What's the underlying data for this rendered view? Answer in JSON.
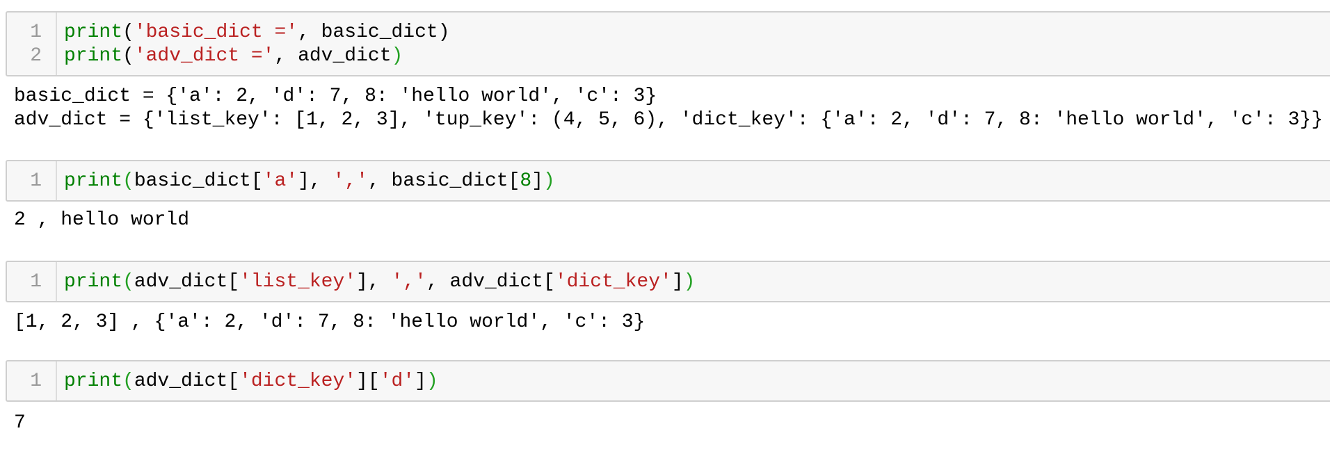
{
  "cells": [
    {
      "lines": [
        {
          "num": "1",
          "tokens": [
            {
              "t": "print",
              "c": "kw"
            },
            {
              "t": "(",
              "c": ""
            },
            {
              "t": "'basic_dict ='",
              "c": "str"
            },
            {
              "t": ", basic_dict)",
              "c": ""
            }
          ]
        },
        {
          "num": "2",
          "tokens": [
            {
              "t": "print",
              "c": "kw"
            },
            {
              "t": "(",
              "c": ""
            },
            {
              "t": "'adv_dict ='",
              "c": "str"
            },
            {
              "t": ", adv_dict",
              "c": ""
            },
            {
              "t": ")",
              "c": "bracket-match"
            }
          ]
        }
      ],
      "output": [
        "basic_dict = {'a': 2, 'd': 7, 8: 'hello world', 'c': 3}",
        "adv_dict = {'list_key': [1, 2, 3], 'tup_key': (4, 5, 6), 'dict_key': {'a': 2, 'd': 7, 8: 'hello world', 'c': 3}}"
      ]
    },
    {
      "lines": [
        {
          "num": "1",
          "tokens": [
            {
              "t": "print",
              "c": "kw"
            },
            {
              "t": "(",
              "c": "bracket-match"
            },
            {
              "t": "basic_dict[",
              "c": ""
            },
            {
              "t": "'a'",
              "c": "str"
            },
            {
              "t": "], ",
              "c": ""
            },
            {
              "t": "','",
              "c": "str"
            },
            {
              "t": ", basic_dict[",
              "c": ""
            },
            {
              "t": "8",
              "c": "num"
            },
            {
              "t": "]",
              "c": ""
            },
            {
              "t": ")",
              "c": "bracket-match"
            }
          ]
        }
      ],
      "output": [
        "2 , hello world"
      ]
    },
    {
      "lines": [
        {
          "num": "1",
          "tokens": [
            {
              "t": "print",
              "c": "kw"
            },
            {
              "t": "(",
              "c": "bracket-match"
            },
            {
              "t": "adv_dict[",
              "c": ""
            },
            {
              "t": "'list_key'",
              "c": "str"
            },
            {
              "t": "], ",
              "c": ""
            },
            {
              "t": "','",
              "c": "str"
            },
            {
              "t": ", adv_dict[",
              "c": ""
            },
            {
              "t": "'dict_key'",
              "c": "str"
            },
            {
              "t": "]",
              "c": ""
            },
            {
              "t": ")",
              "c": "bracket-match"
            }
          ]
        }
      ],
      "output": [
        "[1, 2, 3] , {'a': 2, 'd': 7, 8: 'hello world', 'c': 3}"
      ]
    },
    {
      "lines": [
        {
          "num": "1",
          "tokens": [
            {
              "t": "print",
              "c": "kw"
            },
            {
              "t": "(",
              "c": "bracket-match"
            },
            {
              "t": "adv_dict[",
              "c": ""
            },
            {
              "t": "'dict_key'",
              "c": "str"
            },
            {
              "t": "][",
              "c": ""
            },
            {
              "t": "'d'",
              "c": "str"
            },
            {
              "t": "]",
              "c": ""
            },
            {
              "t": ")",
              "c": "bracket-match"
            }
          ]
        }
      ],
      "output": [
        "7"
      ]
    }
  ],
  "colors": {
    "keyword": "#008000",
    "string": "#ba2121",
    "number": "#008000",
    "bracket_match": "#22a022",
    "cell_background": "#f7f7f7",
    "line_number": "#999999"
  }
}
